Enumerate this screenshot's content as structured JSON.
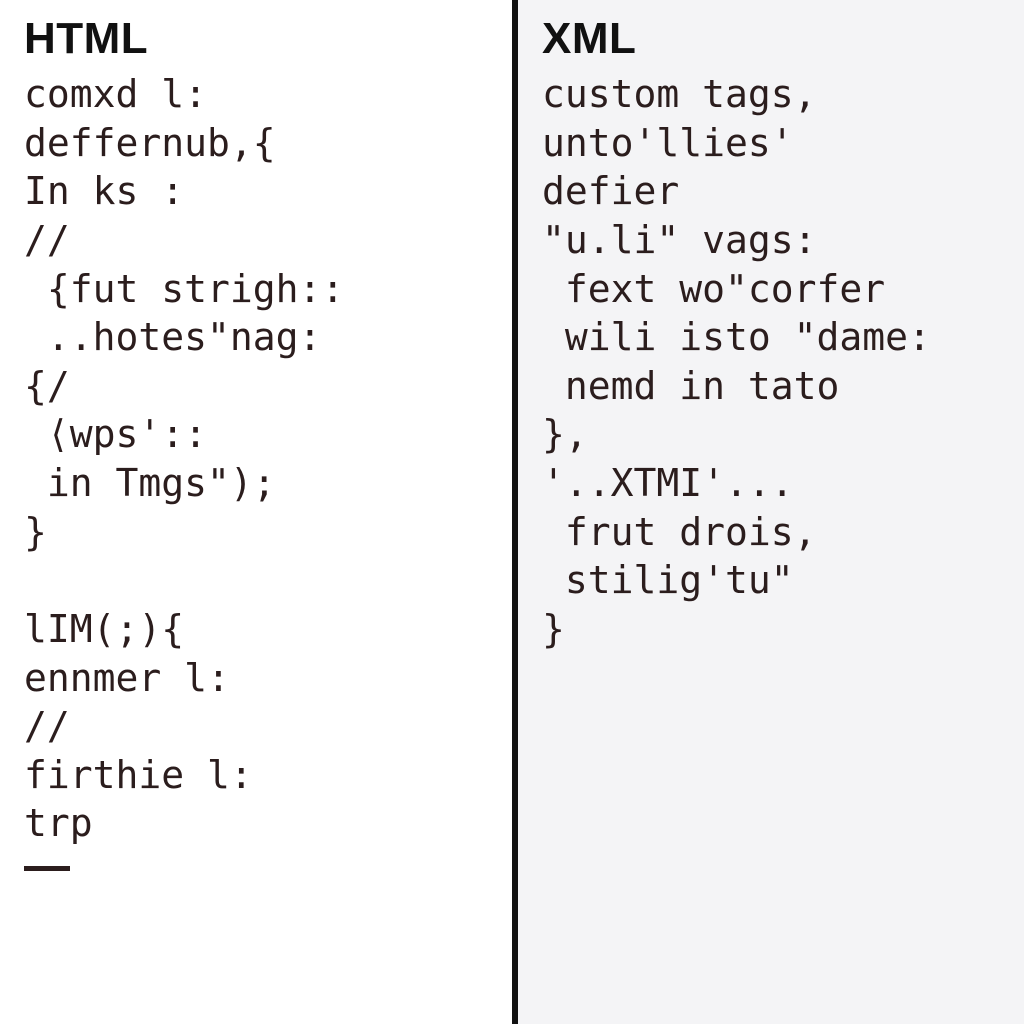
{
  "left": {
    "heading": "HTML",
    "code": "comxd l:\ndeffernub,{\nIn ks :\n//\n {fut strigh::\n ..hotes\"nag:\n{/\n ⟨wps'::\n in Tmgs\");\n}\n\nlIM(;){\nennmer l:\n//\nfirthie l:\ntrp"
  },
  "right": {
    "heading": "XML",
    "code": "custom tags,\nunto'llies'\ndefier\n\"u.li\" vags:\n fext wo\"corfer\n wili isto \"dame:\n nemd in tato\n},\n'..XTMI'...\n frut drois,\n stilig'tu\"\n}"
  }
}
